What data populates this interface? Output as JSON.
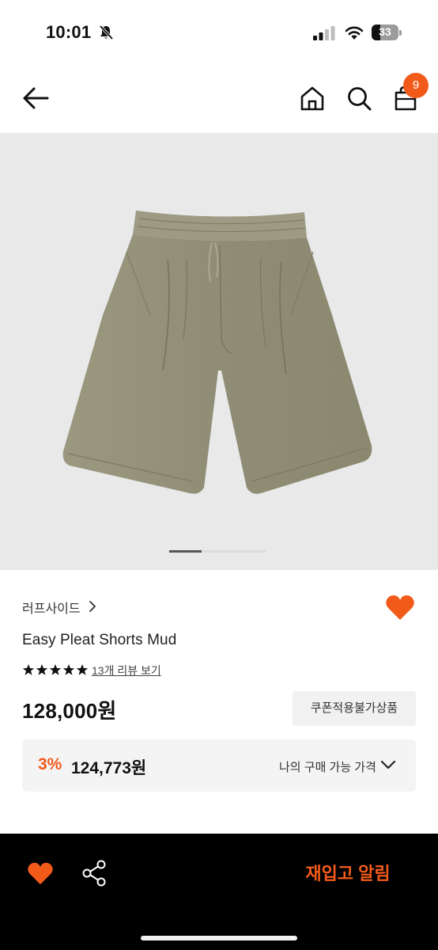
{
  "status_bar": {
    "time": "10:01",
    "battery_level": "33",
    "icons": [
      "bell-slash-icon",
      "signal-icon",
      "wifi-icon",
      "battery-icon"
    ]
  },
  "nav": {
    "icons": [
      "back-arrow-icon",
      "home-icon",
      "search-icon",
      "shopping-bag-icon"
    ],
    "cart_count": "9"
  },
  "product": {
    "image_subject": "shorts",
    "carousel": {
      "current": 1,
      "total": 3
    },
    "brand": "러프사이드",
    "name": "Easy Pleat Shorts Mud",
    "rating": 5,
    "review_link": "13개 리뷰 보기",
    "price": "128,000원",
    "coupon_note": "쿠폰적용불가상품",
    "my_price": {
      "discount": "3%",
      "price": "124,773원",
      "label": "나의 구매 가능 가격"
    }
  },
  "bottom_bar": {
    "restock_label": "재입고 알림",
    "icons": [
      "heart-icon",
      "share-icon"
    ]
  },
  "colors": {
    "accent": "#f25a1a",
    "image_bg": "#e9e9e9",
    "shorts": "#8f8d75",
    "bottom_bar": "#000000"
  }
}
